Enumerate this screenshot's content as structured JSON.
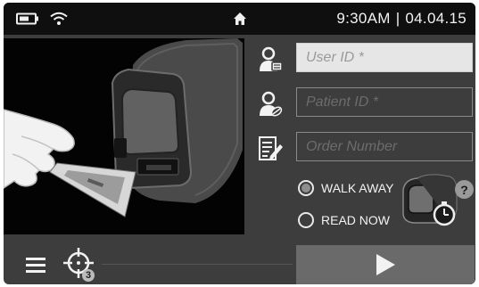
{
  "status_bar": {
    "battery_icon": "battery-icon",
    "wifi_icon": "wifi-icon",
    "home_icon": "home-icon",
    "time": "9:30AM",
    "separator": "|",
    "date": "04.04.15"
  },
  "form": {
    "user_id_placeholder": "User ID *",
    "patient_id_placeholder": "Patient ID *",
    "order_number_placeholder": "Order Number"
  },
  "mode": {
    "walk_away_label": "WALK AWAY",
    "read_now_label": "READ NOW",
    "selected": "walk_away",
    "help_label": "?"
  },
  "bottom": {
    "menu_icon": "hamburger-menu-icon",
    "target_icon": "crosshair-target-icon",
    "target_badge": "3",
    "start_icon": "play-icon"
  },
  "colors": {
    "screen_background": "#3d3d3d",
    "status_bar": "#0f0f0f",
    "start_button": "#6a6a6a"
  }
}
